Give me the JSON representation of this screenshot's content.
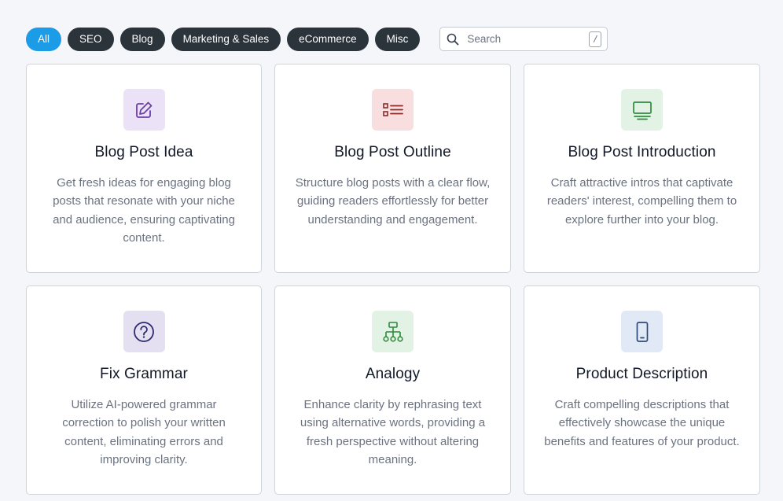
{
  "filters": [
    {
      "label": "All",
      "active": true
    },
    {
      "label": "SEO",
      "active": false
    },
    {
      "label": "Blog",
      "active": false
    },
    {
      "label": "Marketing & Sales",
      "active": false
    },
    {
      "label": "eCommerce",
      "active": false
    },
    {
      "label": "Misc",
      "active": false
    }
  ],
  "search": {
    "placeholder": "Search",
    "value": "",
    "shortcut": "/",
    "icon": "magnifier-icon"
  },
  "cards": [
    {
      "title": "Blog Post Idea",
      "description": "Get fresh ideas for engaging blog posts that resonate with your niche and audience, ensuring captivating content.",
      "icon": "pencil-square-icon",
      "icon_color": "#6b3fa8",
      "icon_bg": "#ece2f7"
    },
    {
      "title": "Blog Post Outline",
      "description": "Structure blog posts with a clear flow, guiding readers effortlessly for better understanding and engagement.",
      "icon": "list-icon",
      "icon_color": "#8b2b2b",
      "icon_bg": "#f8dede"
    },
    {
      "title": "Blog Post Introduction",
      "description": "Craft attractive intros that captivate readers' interest, compelling them to explore further into your blog.",
      "icon": "monitor-icon",
      "icon_color": "#2f8a3c",
      "icon_bg": "#e2f2e4"
    },
    {
      "title": "Fix Grammar",
      "description": "Utilize AI-powered grammar correction to polish your written content, eliminating errors and improving clarity.",
      "icon": "question-circle-icon",
      "icon_color": "#2d2a6e",
      "icon_bg": "#e4e0f1"
    },
    {
      "title": "Analogy",
      "description": "Enhance clarity by rephrasing text using alternative words, providing a fresh perspective without altering meaning.",
      "icon": "hierarchy-icon",
      "icon_color": "#2f8a3c",
      "icon_bg": "#e2f2e4"
    },
    {
      "title": "Product Description",
      "description": "Craft compelling descriptions that effectively showcase the unique benefits and features of your product.",
      "icon": "smartphone-icon",
      "icon_color": "#2f4a78",
      "icon_bg": "#e1e9f7"
    }
  ]
}
